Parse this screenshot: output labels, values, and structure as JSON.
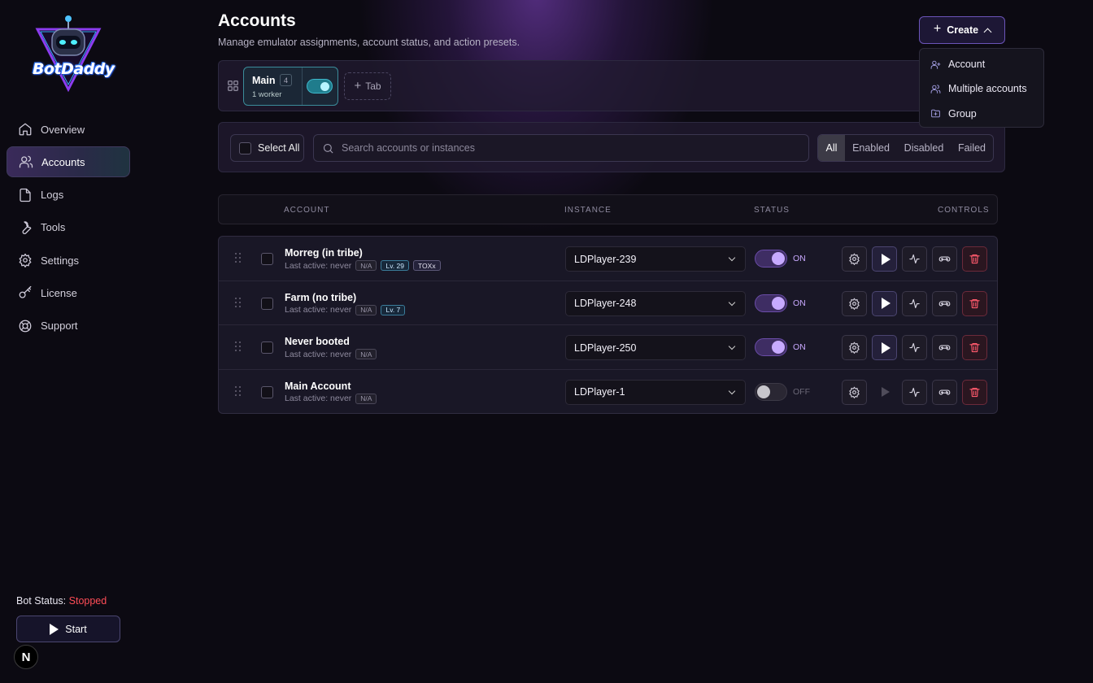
{
  "app": {
    "logo_text": "BotDaddy"
  },
  "sidebar": {
    "items": [
      {
        "label": "Overview",
        "icon": "home-icon"
      },
      {
        "label": "Accounts",
        "icon": "users-icon",
        "active": true
      },
      {
        "label": "Logs",
        "icon": "file-icon"
      },
      {
        "label": "Tools",
        "icon": "wrench-icon"
      },
      {
        "label": "Settings",
        "icon": "gear-icon"
      },
      {
        "label": "License",
        "icon": "key-icon"
      },
      {
        "label": "Support",
        "icon": "lifebuoy-icon"
      }
    ],
    "bot_status_label": "Bot Status:",
    "bot_status_value": "Stopped",
    "start_label": "Start",
    "badge_letter": "N"
  },
  "header": {
    "title": "Accounts",
    "subtitle": "Manage emulator assignments, account status, and action presets.",
    "create_label": "Create"
  },
  "create_menu": {
    "items": [
      {
        "label": "Account",
        "icon": "user-plus-icon"
      },
      {
        "label": "Multiple accounts",
        "icon": "users-icon"
      },
      {
        "label": "Group",
        "icon": "folder-plus-icon"
      }
    ]
  },
  "tabs": {
    "main": {
      "name": "Main",
      "count": "4",
      "workers": "1 worker",
      "enabled": true
    },
    "add_label": "Tab"
  },
  "filters": {
    "select_all_label": "Select All",
    "search_placeholder": "Search accounts or instances",
    "segments": [
      {
        "label": "All",
        "active": true
      },
      {
        "label": "Enabled"
      },
      {
        "label": "Disabled"
      },
      {
        "label": "Failed"
      }
    ]
  },
  "table": {
    "columns": [
      "ACCOUNT",
      "INSTANCE",
      "STATUS",
      "CONTROLS"
    ],
    "rows": [
      {
        "name": "Morreg (in tribe)",
        "last_active": "Last active: never",
        "badge_na": "N/A",
        "level": "Lv. 29",
        "tag": "TOXx",
        "instance": "LDPlayer-239",
        "status": "ON"
      },
      {
        "name": "Farm (no tribe)",
        "last_active": "Last active: never",
        "badge_na": "N/A",
        "level": "Lv. 7",
        "tag": "",
        "instance": "LDPlayer-248",
        "status": "ON"
      },
      {
        "name": "Never booted",
        "last_active": "Last active: never",
        "badge_na": "N/A",
        "level": "",
        "tag": "",
        "instance": "LDPlayer-250",
        "status": "ON"
      },
      {
        "name": "Main Account",
        "last_active": "Last active: never",
        "badge_na": "N/A",
        "level": "",
        "tag": "",
        "instance": "LDPlayer-1",
        "status": "OFF"
      }
    ]
  },
  "colors": {
    "accent": "#7c5cff",
    "stopped": "#ff4d57",
    "teal": "#3fb8cb",
    "danger": "#ff5a6c"
  }
}
